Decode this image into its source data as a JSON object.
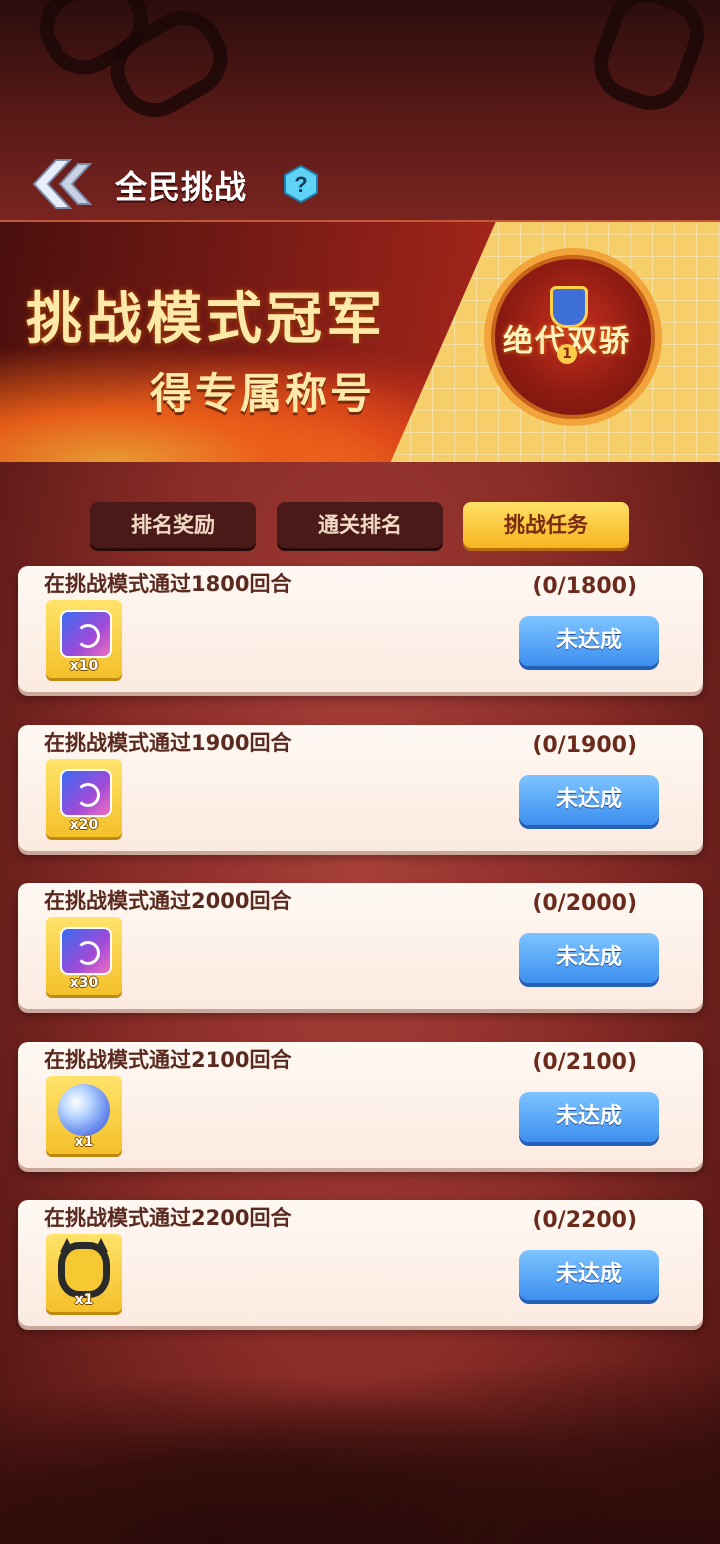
{
  "header": {
    "title": "全民挑战",
    "help_icon_text": "?"
  },
  "banner": {
    "line1": "挑战模式冠军",
    "line2": "得专属称号",
    "badge_text": "绝代双骄",
    "badge_number": "1"
  },
  "tabs": [
    {
      "label": "排名奖励",
      "active": false
    },
    {
      "label": "通关排名",
      "active": false
    },
    {
      "label": "挑战任务",
      "active": true
    }
  ],
  "tasks": [
    {
      "title": "在挑战模式通过1800回合",
      "progress": "(0/1800)",
      "reward_icon": "puzzle-fragment-icon",
      "reward_qty": "x10",
      "status": "未达成"
    },
    {
      "title": "在挑战模式通过1900回合",
      "progress": "(0/1900)",
      "reward_icon": "puzzle-fragment-icon",
      "reward_qty": "x20",
      "status": "未达成"
    },
    {
      "title": "在挑战模式通过2000回合",
      "progress": "(0/2000)",
      "reward_icon": "puzzle-fragment-icon",
      "reward_qty": "x30",
      "status": "未达成"
    },
    {
      "title": "在挑战模式通过2100回合",
      "progress": "(0/2100)",
      "reward_icon": "crystal-orb-icon",
      "reward_qty": "x1",
      "status": "未达成"
    },
    {
      "title": "在挑战模式通过2200回合",
      "progress": "(0/2200)",
      "reward_icon": "avatar-frame-icon",
      "reward_qty": "x1",
      "status": "未达成"
    }
  ],
  "colors": {
    "accent_gold": "#f6b520",
    "button_blue": "#3d8ff0",
    "background_red": "#8a2c27"
  }
}
